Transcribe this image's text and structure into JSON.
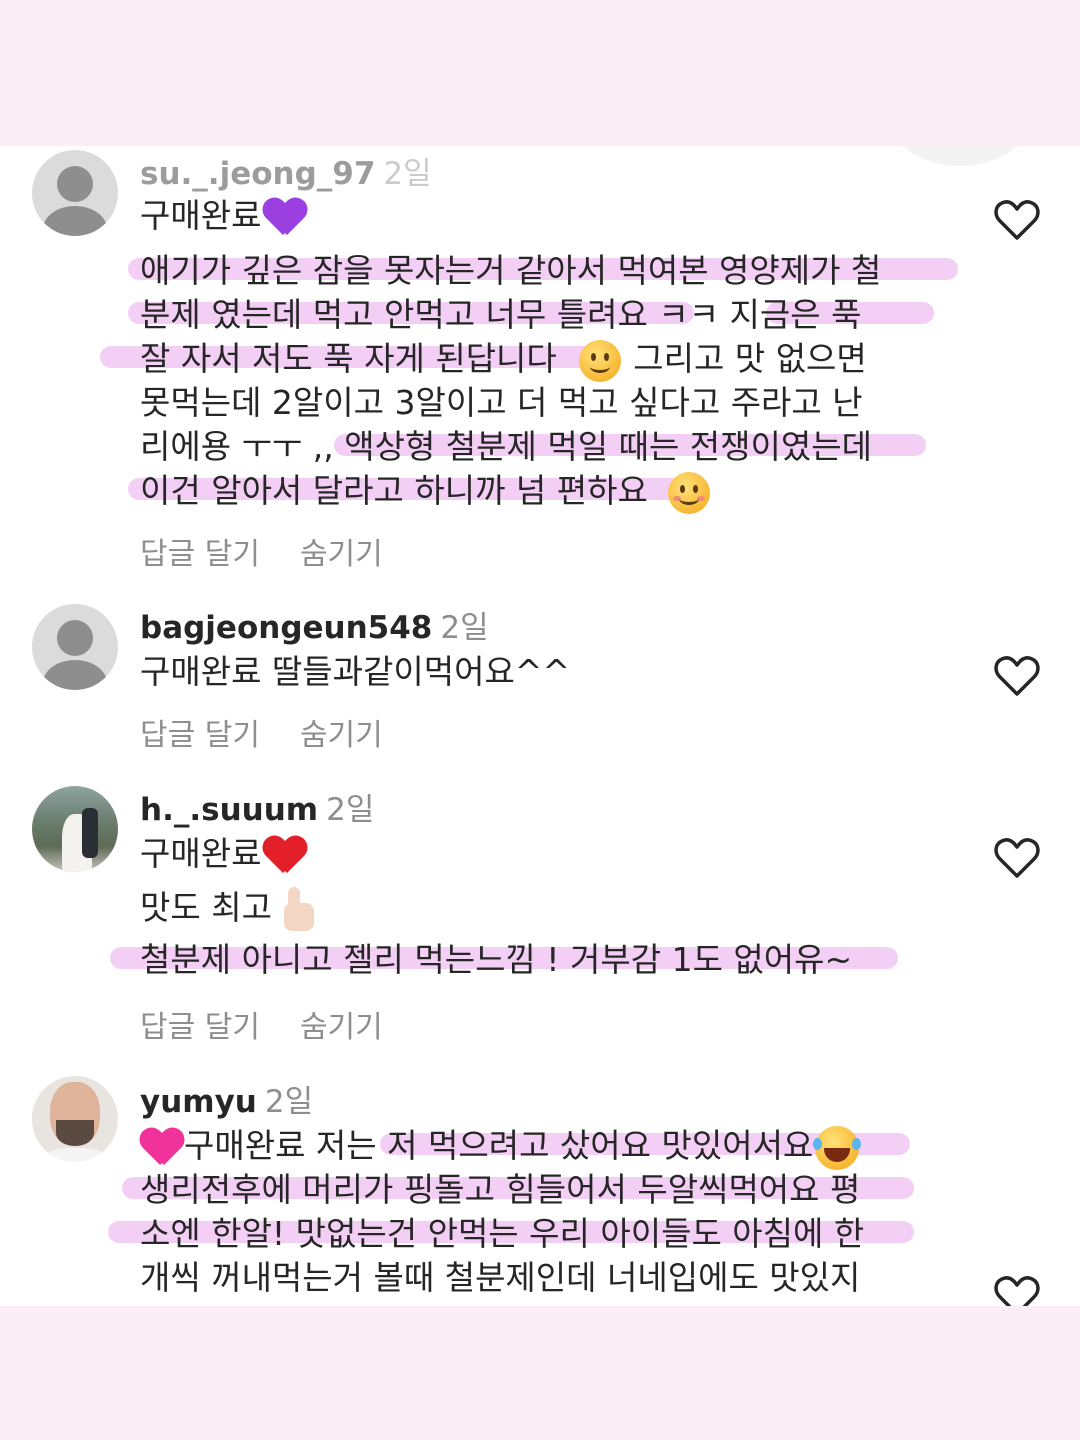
{
  "comments": [
    {
      "username": "su._.jeong_97",
      "time": "2일",
      "lines": [
        "구매완료",
        "애기가 깊은 잠을 못자는거 같아서 먹여본 영양제가 철",
        "분제 였는데 먹고 안먹고 너무 틀려요 ㅋㅋ 지금은 푹",
        "잘 자서 저도 푹 자게 된답니다",
        "그리고 맛 없으면",
        "못먹는데 2알이고 3알이고 더 먹고 싶다고 주라고 난",
        "리에용 ㅜㅜ ,, 액상형 철분제 먹일 때는 전쟁이였는데",
        "이건 알아서 달라고 하니까 넘 편하요"
      ],
      "emojis": [
        "purple-heart",
        "slightly-smiling-face",
        "smiling-face"
      ],
      "reply_label": "답글 달기",
      "hide_label": "숨기기"
    },
    {
      "username": "bagjeongeun548",
      "time": "2일",
      "lines": [
        "구매완료 딸들과같이먹어요^^"
      ],
      "reply_label": "답글 달기",
      "hide_label": "숨기기"
    },
    {
      "username": "h._.suuum",
      "time": "2일",
      "lines": [
        "구매완료",
        "맛도 최고",
        "철분제 아니고 젤리 먹는느낌 ! 거부감 1도 없어유~"
      ],
      "emojis": [
        "red-heart",
        "thumbs-up"
      ],
      "reply_label": "답글 달기",
      "hide_label": "숨기기"
    },
    {
      "username": "yumyu",
      "time": "2일",
      "lines": [
        "구매완료 저는 저 먹으려고 샀어요 맛있어서요",
        "생리전후에 머리가 핑돌고 힘들어서 두알씩먹어요 평",
        "소엔 한알! 맛없는건 안먹는 우리 아이들도 아침에 한",
        "개씩 꺼내먹는거 볼때 철분제인데 너네입에도 맛있지"
      ],
      "emojis": [
        "pink-heart",
        "tears-of-joy"
      ]
    }
  ],
  "colors": {
    "background": "#fbeef6",
    "highlight": "#f0bff2",
    "text": "#262626",
    "muted": "#8e8e8e"
  }
}
